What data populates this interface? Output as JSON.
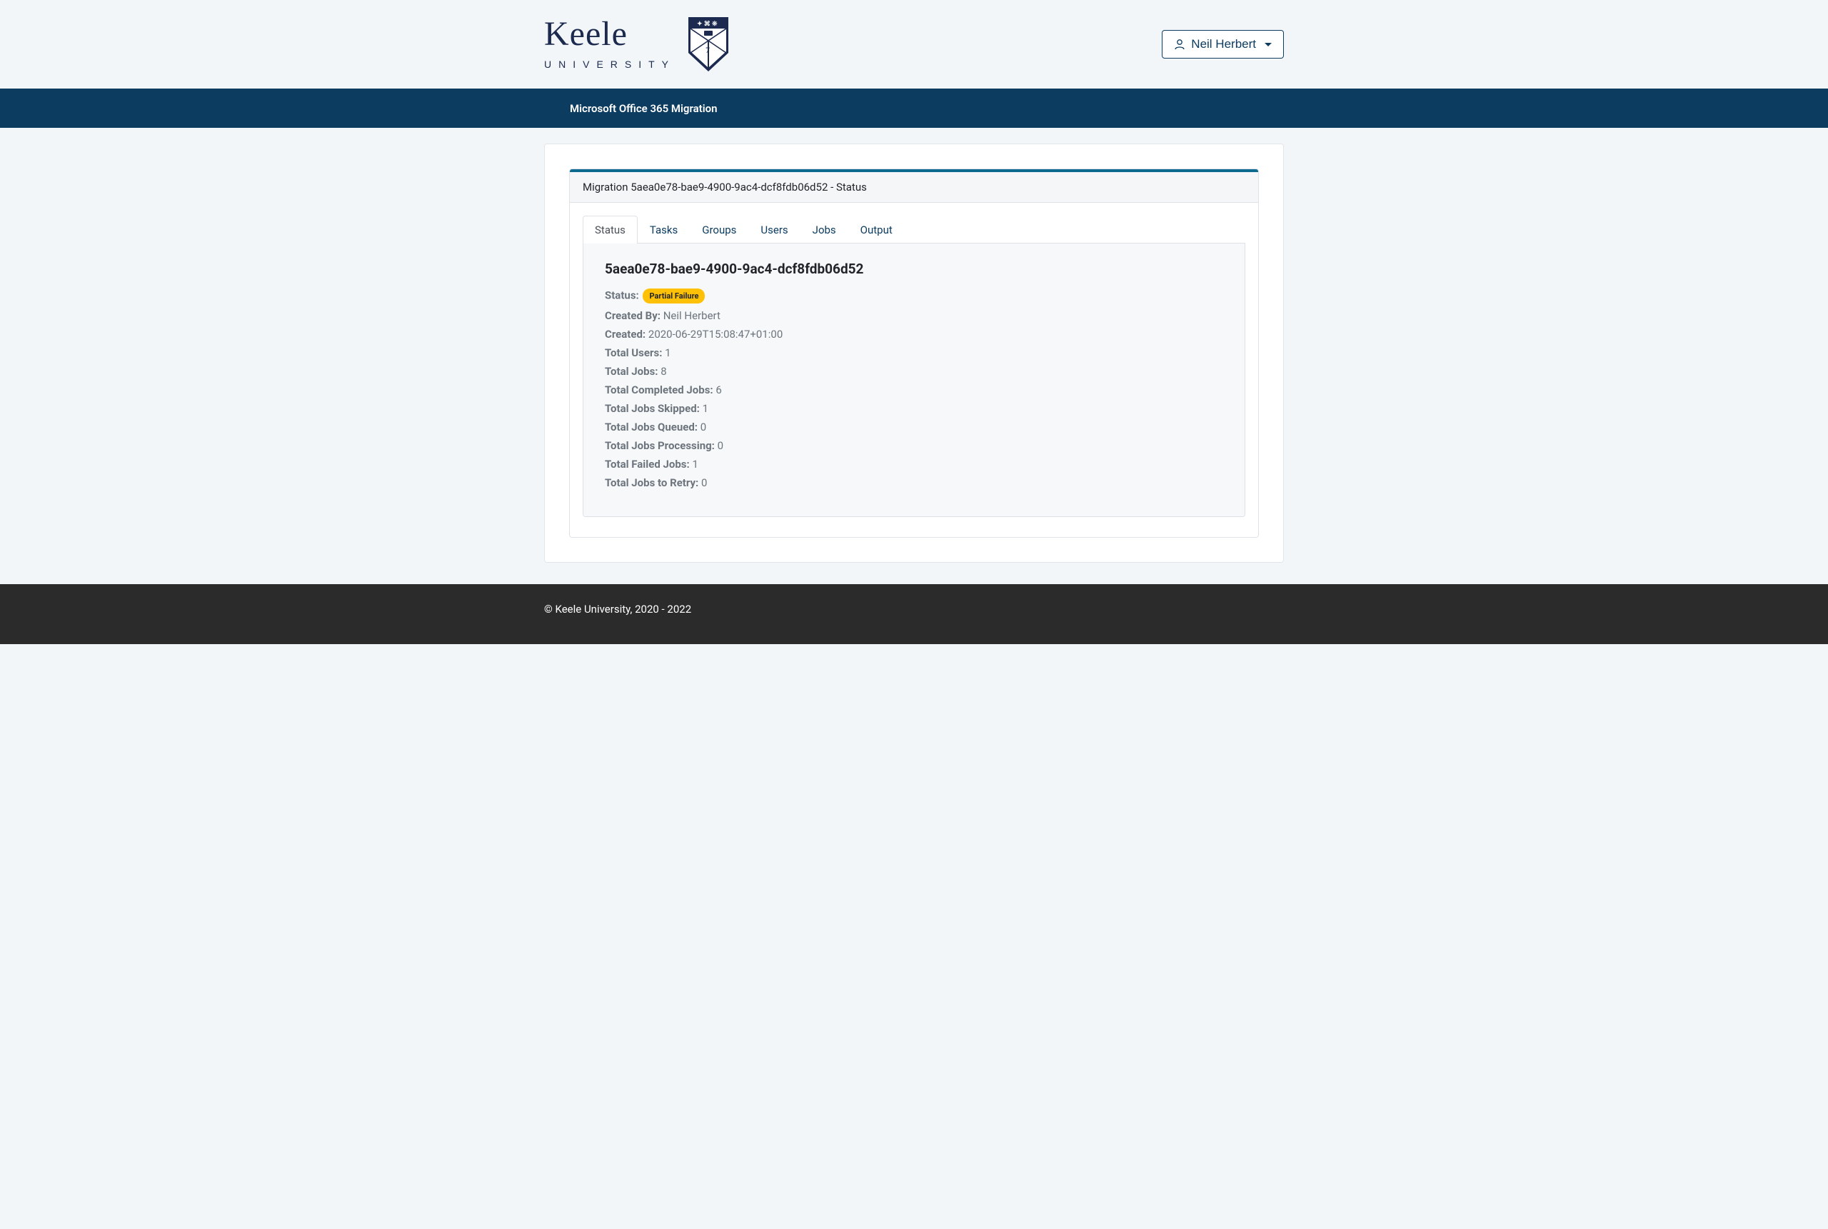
{
  "brand": {
    "name": "Keele",
    "sub": "UNIVERSITY"
  },
  "user": {
    "name": "Neil Herbert"
  },
  "nav": {
    "title": "Microsoft Office 365 Migration"
  },
  "panel": {
    "header": "Migration 5aea0e78-bae9-4900-9ac4-dcf8fdb06d52 - Status"
  },
  "tabs": {
    "status": "Status",
    "tasks": "Tasks",
    "groups": "Groups",
    "users": "Users",
    "jobs": "Jobs",
    "output": "Output"
  },
  "status": {
    "migration_id": "5aea0e78-bae9-4900-9ac4-dcf8fdb06d52",
    "labels": {
      "status": "Status:",
      "created_by": "Created By:",
      "created": "Created:",
      "total_users": "Total Users:",
      "total_jobs": "Total Jobs:",
      "total_completed": "Total Completed Jobs:",
      "total_skipped": "Total Jobs Skipped:",
      "total_queued": "Total Jobs Queued:",
      "total_processing": "Total Jobs Processing:",
      "total_failed": "Total Failed Jobs:",
      "total_retry": "Total Jobs to Retry:"
    },
    "values": {
      "status_badge": "Partial Failure",
      "created_by": "Neil Herbert",
      "created": "2020-06-29T15:08:47+01:00",
      "total_users": "1",
      "total_jobs": "8",
      "total_completed": "6",
      "total_skipped": "1",
      "total_queued": "0",
      "total_processing": "0",
      "total_failed": "1",
      "total_retry": "0"
    }
  },
  "footer": {
    "copyright": "© Keele University, 2020 - 2022"
  }
}
